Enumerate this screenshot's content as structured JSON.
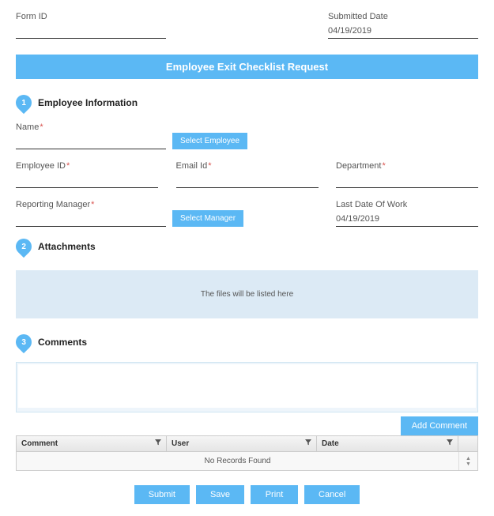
{
  "top": {
    "form_id_label": "Form ID",
    "form_id_value": "",
    "submitted_label": "Submitted Date",
    "submitted_value": "04/19/2019"
  },
  "banner": "Employee Exit Checklist Request",
  "sections": {
    "s1": {
      "num": "1",
      "title": "Employee Information"
    },
    "s2": {
      "num": "2",
      "title": "Attachments"
    },
    "s3": {
      "num": "3",
      "title": "Comments"
    }
  },
  "emp": {
    "name_label": "Name",
    "name_value": "",
    "select_emp_btn": "Select Employee",
    "empid_label": "Employee ID",
    "empid_value": "",
    "email_label": "Email Id",
    "email_value": "",
    "dept_label": "Department",
    "dept_value": "",
    "mgr_label": "Reporting Manager",
    "mgr_value": "",
    "select_mgr_btn": "Select Manager",
    "lastday_label": "Last Date Of Work",
    "lastday_value": "04/19/2019"
  },
  "files": {
    "placeholder": "The files will be listed here"
  },
  "comments": {
    "add_btn": "Add Comment",
    "cols": {
      "comment": "Comment",
      "user": "User",
      "date": "Date"
    },
    "empty": "No Records Found"
  },
  "actions": {
    "submit": "Submit",
    "save": "Save",
    "print": "Print",
    "cancel": "Cancel"
  }
}
